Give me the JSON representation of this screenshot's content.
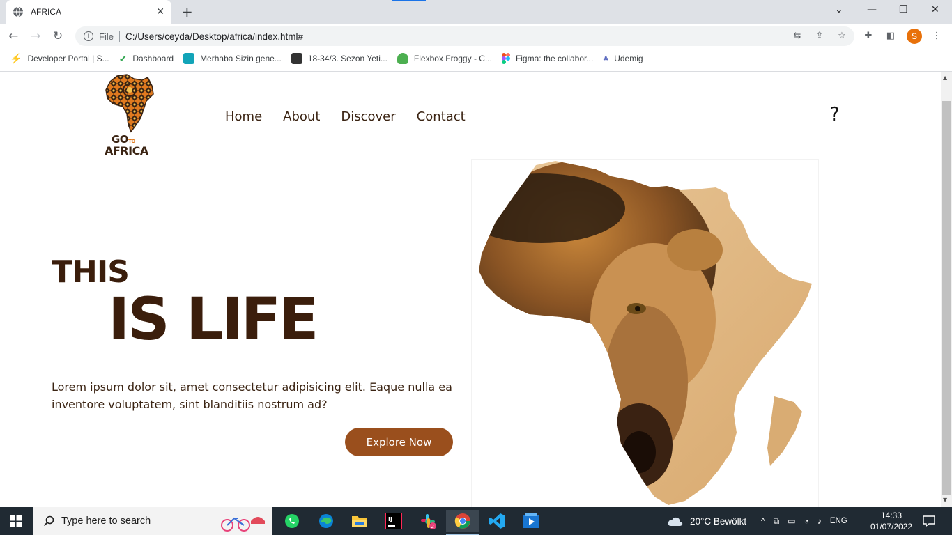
{
  "browser": {
    "tab_title": "AFRICA",
    "address_prefix": "File",
    "url": "C:/Users/ceyda/Desktop/africa/index.html#",
    "profile_initial": "S",
    "bookmarks": [
      {
        "label": "Developer Portal | S...",
        "icon": "bolt-icon",
        "color": "#1a73e8"
      },
      {
        "label": "Dashboard",
        "icon": "check-circle-icon",
        "color": "#34a853"
      },
      {
        "label": "Merhaba Sizin gene...",
        "icon": "classroom-icon",
        "color": "#12a4b8"
      },
      {
        "label": "18-34/3. Sezon Yeti...",
        "icon": "contact-card-icon",
        "color": "#333333"
      },
      {
        "label": "Flexbox Froggy - C...",
        "icon": "frog-icon",
        "color": "#4caf50"
      },
      {
        "label": "Figma: the collabor...",
        "icon": "figma-icon",
        "color": "#f24e1e"
      },
      {
        "label": "Udemig",
        "icon": "udemig-icon",
        "color": "#5c6bc0"
      }
    ]
  },
  "site": {
    "logo_go": "GO",
    "logo_to": "TO",
    "logo_africa": "AFRICA",
    "nav": [
      "Home",
      "About",
      "Discover",
      "Contact"
    ],
    "help_mark": "?",
    "headline_1": "THIS",
    "headline_2": "IS LIFE",
    "body": "Lorem ipsum dolor sit, amet consectetur adipisicing elit. Eaque nulla ea inventore voluptatem, sint blanditiis nostrum ad?",
    "cta": "Explore Now",
    "colors": {
      "brand_brown": "#3b1e0c",
      "button": "#9a4f1d",
      "accent_orange": "#e07a1f"
    }
  },
  "taskbar": {
    "search_placeholder": "Type here to search",
    "weather": "20°C  Bewölkt",
    "language": "ENG",
    "time": "14:33",
    "date": "01/07/2022",
    "apps": [
      "whatsapp-icon",
      "edge-icon",
      "file-explorer-icon",
      "intellij-icon",
      "slack-icon",
      "chrome-icon",
      "vscode-icon",
      "media-player-icon"
    ]
  }
}
